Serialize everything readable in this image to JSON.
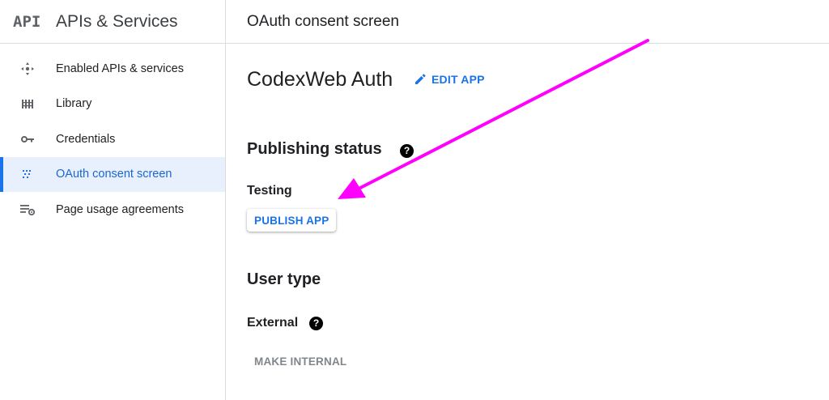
{
  "sidebar": {
    "logo_text": "API",
    "title": "APIs & Services",
    "items": [
      {
        "label": "Enabled APIs & services",
        "icon": "enabled-apis-icon",
        "active": false
      },
      {
        "label": "Library",
        "icon": "library-icon",
        "active": false
      },
      {
        "label": "Credentials",
        "icon": "key-icon",
        "active": false
      },
      {
        "label": "OAuth consent screen",
        "icon": "oauth-consent-icon",
        "active": true
      },
      {
        "label": "Page usage agreements",
        "icon": "page-usage-settings-icon",
        "active": false
      }
    ]
  },
  "header": {
    "title": "OAuth consent screen"
  },
  "main": {
    "app_name": "CodexWeb Auth",
    "edit_label": "EDIT APP",
    "publishing": {
      "title": "Publishing status",
      "status": "Testing",
      "publish_label": "PUBLISH APP"
    },
    "user_type": {
      "title": "User type",
      "value": "External",
      "make_internal_label": "MAKE INTERNAL"
    }
  },
  "colors": {
    "accent": "#1a73e8",
    "active_bg": "#e8f0fe",
    "annotation_arrow": "#ff00ff",
    "muted_text": "#80868b"
  }
}
